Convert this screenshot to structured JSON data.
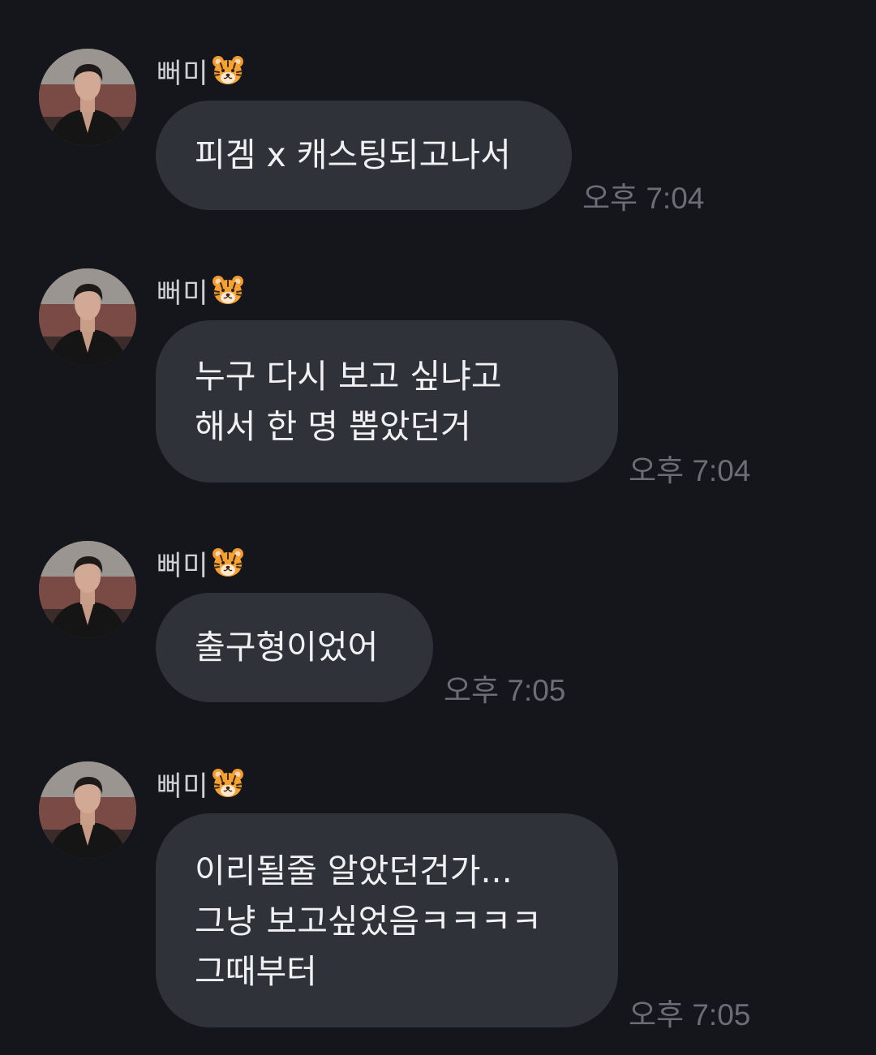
{
  "colors": {
    "background": "#15161b",
    "bubble": "#30323a",
    "text": "#f1f1f3",
    "name": "#cfd0d4",
    "time": "#6c6e76"
  },
  "messages": [
    {
      "sender": "뻐미",
      "sender_icon": "tiger-face-emoji",
      "avatar": "profile-photo",
      "lines": [
        "피겜 x 캐스팅되고나서"
      ],
      "time": "오후 7:04"
    },
    {
      "sender": "뻐미",
      "sender_icon": "tiger-face-emoji",
      "avatar": "profile-photo",
      "lines": [
        "누구 다시 보고 싶냐고",
        "해서 한 명 뽑았던거"
      ],
      "time": "오후 7:04"
    },
    {
      "sender": "뻐미",
      "sender_icon": "tiger-face-emoji",
      "avatar": "profile-photo",
      "lines": [
        "출구형이었어"
      ],
      "time": "오후 7:05"
    },
    {
      "sender": "뻐미",
      "sender_icon": "tiger-face-emoji",
      "avatar": "profile-photo",
      "lines": [
        "이리될줄 알았던건가...",
        "그냥 보고싶었음ㅋㅋㅋㅋ",
        "그때부터"
      ],
      "time": "오후 7:05"
    }
  ]
}
